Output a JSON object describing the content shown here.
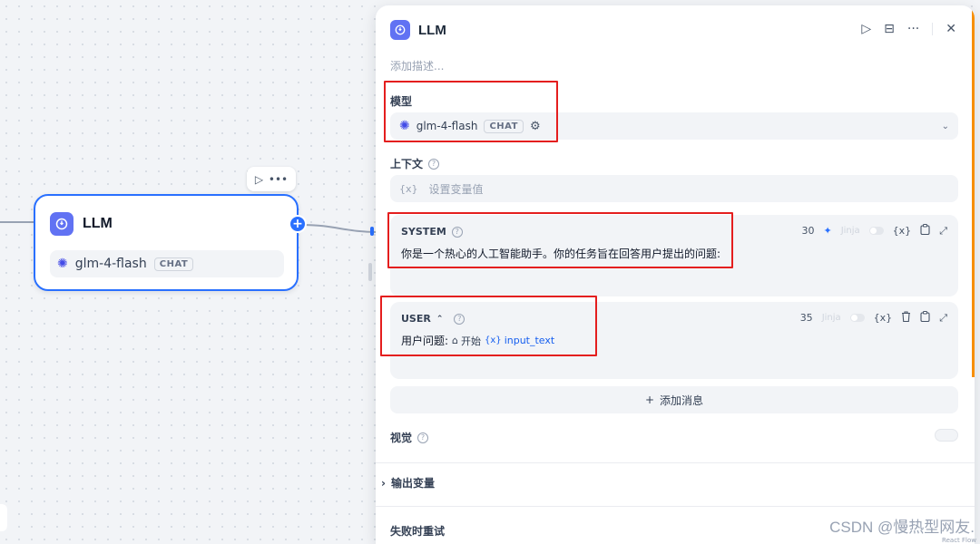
{
  "canvas": {
    "node": {
      "title": "LLM",
      "model": "glm-4-flash",
      "model_badge": "CHAT",
      "add_symbol": "+",
      "toolbar": {
        "run_icon": "▷",
        "more_icon": "•••"
      }
    }
  },
  "panel": {
    "title": "LLM",
    "description_placeholder": "添加描述...",
    "actions": {
      "run": "▷",
      "split": "⊟",
      "more": "···",
      "close": "✕"
    },
    "model": {
      "label": "模型",
      "name": "glm-4-flash",
      "badge": "CHAT",
      "settings_icon": "⚙",
      "chevron": "⌄"
    },
    "context": {
      "label": "上下文",
      "var_symbol": "{x}",
      "placeholder": "设置变量值"
    },
    "system_prompt": {
      "role": "SYSTEM",
      "count": "30",
      "jinja": "Jinja",
      "var_symbol": "{x}",
      "text": "你是一个热心的人工智能助手。你的任务旨在回答用户提出的问题:"
    },
    "user_prompt": {
      "role": "USER",
      "role_arrow": "⌃",
      "count": "35",
      "jinja": "Jinja",
      "var_symbol": "{x}",
      "text_prefix": "用户问题:",
      "start_node": "开始",
      "variable": "input_text",
      "var_chip_symbol": "{x}"
    },
    "add_message": {
      "plus": "+",
      "label": "添加消息"
    },
    "vision": {
      "label": "视觉"
    },
    "output_vars": {
      "arrow": "›",
      "label": "输出变量"
    },
    "retry": {
      "label": "失败时重试"
    }
  },
  "watermark": "CSDN @慢热型网友.",
  "attribution": "React Flow",
  "colors": {
    "accent": "#2970ff",
    "highlight": "#e41e1e",
    "node_icon": "#6172f3"
  }
}
